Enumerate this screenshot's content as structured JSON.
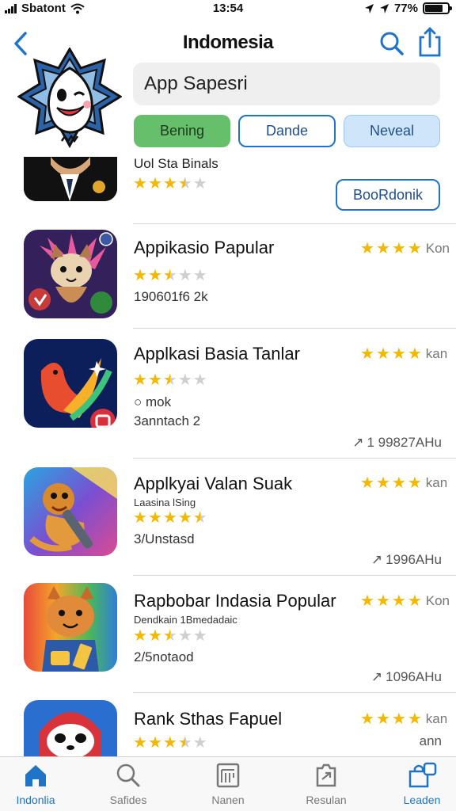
{
  "status_bar": {
    "carrier": "Sbatont",
    "time": "13:54",
    "battery": "77%"
  },
  "nav": {
    "title": "Indomesia"
  },
  "search": {
    "value": "App Sapesri"
  },
  "filters": [
    "Bening",
    "Dande",
    "Neveal"
  ],
  "featured": {
    "subtitle": "Uol Sta Binals",
    "rating": 3.5,
    "button_label": "BooRdonik"
  },
  "apps": [
    {
      "name": "Appikasio Papular",
      "stars": 2.5,
      "sub": "190601f6 2k",
      "side_label": "Kon",
      "size": ""
    },
    {
      "name": "Applkasi Basia Tanlar",
      "stars": 2.5,
      "sub": "○ mok",
      "sub2": "3anntach 2",
      "side_label": "kan",
      "size": "1 99827AHu"
    },
    {
      "name": "Applkyai Valan Suak",
      "tagline": "Laasina lSing",
      "stars": 4.5,
      "sub": "3/Unstasd",
      "side_label": "kan",
      "size": "1996AHu"
    },
    {
      "name": "Rapbobar Indasia Popular",
      "tagline": "Dendkain 1Bmedadaic",
      "stars": 2.5,
      "sub": "2/5notaod",
      "side_label": "Kon",
      "size": "1096AHu"
    },
    {
      "name": "Rank Sthas Fapuel",
      "stars": 3.5,
      "sub": "",
      "side_label": "kan",
      "side_label2": "ann",
      "size": ""
    }
  ],
  "tabs": [
    {
      "label": "Indonlia",
      "icon": "home-icon",
      "active": true
    },
    {
      "label": "Safides",
      "icon": "search-icon",
      "active": false
    },
    {
      "label": "Nanen",
      "icon": "news-icon",
      "active": false
    },
    {
      "label": "Resulan",
      "icon": "updates-icon",
      "active": false
    },
    {
      "label": "Leaden",
      "icon": "bag-icon",
      "active": false
    }
  ],
  "colors": {
    "accent": "#1f74c7",
    "green_chip": "#66c06b",
    "star": "#f5b800"
  }
}
